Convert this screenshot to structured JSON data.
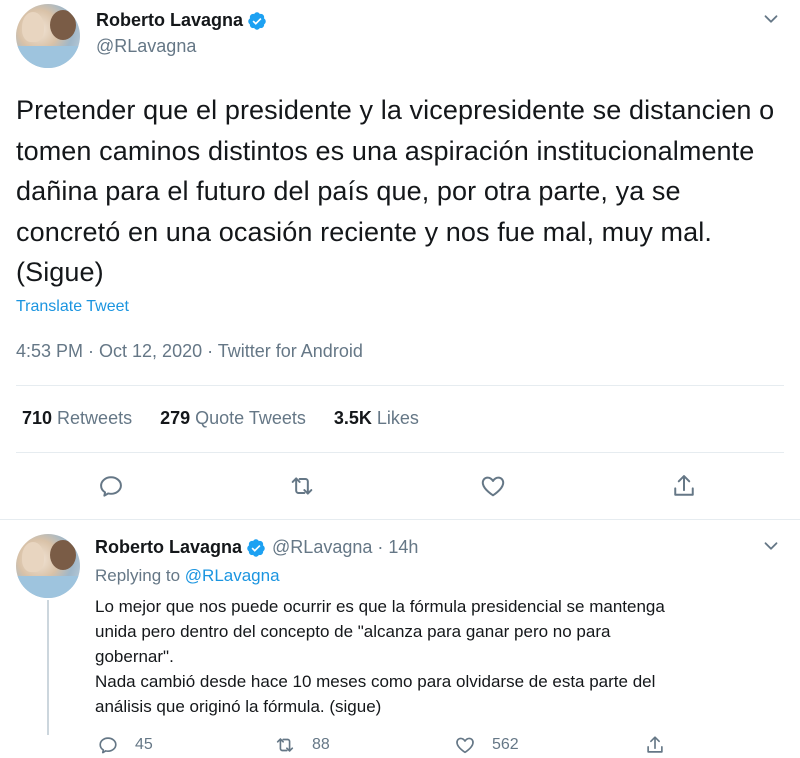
{
  "tweet": {
    "author_name": "Roberto Lavagna",
    "author_handle": "@RLavagna",
    "text": "Pretender que el presidente y la vicepresidente se distancien o tomen caminos distintos es una aspiración institucionalmente dañina para el futuro del país que, por otra parte, ya se concretó en una ocasión reciente y nos fue mal, muy mal. (Sigue)",
    "translate_label": "Translate Tweet",
    "meta": "4:53 PM · Oct 12, 2020 · Twitter for Android",
    "stats": [
      {
        "num": "710",
        "label": "Retweets"
      },
      {
        "num": "279",
        "label": "Quote Tweets"
      },
      {
        "num": "3.5K",
        "label": "Likes"
      }
    ],
    "icons": [
      "reply-icon",
      "retweet-icon",
      "like-icon",
      "share-icon"
    ]
  },
  "reply": {
    "author_name": "Roberto Lavagna",
    "author_handle_time": "@RLavagna · 14h",
    "replying_prefix": "Replying to ",
    "replying_to": "@RLavagna",
    "lines": [
      "Lo mejor que nos puede ocurrir es que la fórmula presidencial se mantenga",
      "unida pero dentro del concepto de \"alcanza para ganar pero no para",
      "gobernar\".",
      "Nada cambió desde hace 10 meses como para olvidarse de esta parte del",
      "análisis que originó la fórmula. (sigue)"
    ],
    "counts": {
      "replies": "45",
      "retweets": "88",
      "likes": "562"
    }
  },
  "colors": {
    "accent": "#1da1f2",
    "link": "#1b95e0",
    "muted": "#657786",
    "text": "#14171a"
  }
}
